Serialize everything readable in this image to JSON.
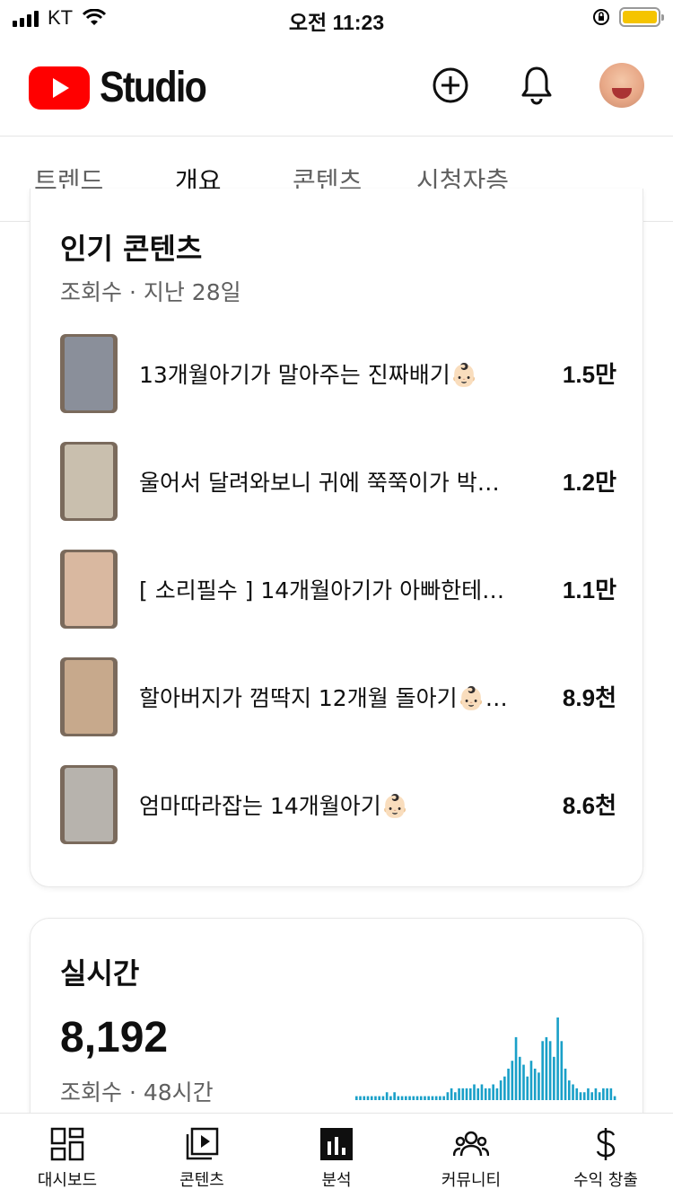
{
  "status_bar": {
    "carrier": "KT",
    "time": "오전 11:23",
    "battery_color": "#f5c400"
  },
  "header": {
    "logo_text": "Studio",
    "brand_color": "#ff0000",
    "icons": [
      "create-icon",
      "bell-icon",
      "avatar"
    ]
  },
  "tabs": [
    {
      "label": "트렌드",
      "active": false
    },
    {
      "label": "개요",
      "active": true
    },
    {
      "label": "콘텐츠",
      "active": false
    },
    {
      "label": "시청자층",
      "active": false
    }
  ],
  "popular": {
    "title": "인기 콘텐츠",
    "subtitle": "조회수 · 지난 28일",
    "videos": [
      {
        "title": "13개월아기가 말아주는 진짜배기👶🏻",
        "views": "1.5만",
        "thumb_color": "#8a8f9a"
      },
      {
        "title": "울어서 달려와보니 귀에 쭉쭉이가 박…",
        "views": "1.2만",
        "thumb_color": "#c9bfae"
      },
      {
        "title": "[ 소리필수 ] 14개월아기가 아빠한테…",
        "views": "1.1만",
        "thumb_color": "#d9b8a0"
      },
      {
        "title": "할아버지가 껌딱지 12개월 돌아기👶🏻…",
        "views": "8.9천",
        "thumb_color": "#c7a98c"
      },
      {
        "title": "엄마따라잡는 14개월아기👶🏻",
        "views": "8.6천",
        "thumb_color": "#b7b3ad"
      }
    ]
  },
  "realtime": {
    "title": "실시간",
    "count": "8,192",
    "subtitle": "조회수 · 48시간"
  },
  "chart_data": {
    "type": "bar",
    "color": "#1aa0c8",
    "values": [
      1,
      1,
      1,
      1,
      1,
      1,
      1,
      1,
      2,
      1,
      2,
      1,
      1,
      1,
      1,
      1,
      1,
      1,
      1,
      1,
      1,
      1,
      1,
      1,
      2,
      3,
      2,
      3,
      3,
      3,
      3,
      4,
      3,
      4,
      3,
      3,
      4,
      3,
      5,
      6,
      8,
      10,
      16,
      11,
      9,
      6,
      10,
      8,
      7,
      15,
      16,
      15,
      11,
      21,
      15,
      8,
      5,
      4,
      3,
      2,
      2,
      3,
      2,
      3,
      2,
      3,
      3,
      3,
      1
    ],
    "ylim": [
      0,
      21
    ],
    "grid": false,
    "xlabel": "",
    "ylabel": ""
  },
  "bottom_nav": [
    {
      "label": "대시보드",
      "icon": "dashboard-icon"
    },
    {
      "label": "콘텐츠",
      "icon": "content-icon"
    },
    {
      "label": "분석",
      "icon": "analytics-icon"
    },
    {
      "label": "커뮤니티",
      "icon": "community-icon"
    },
    {
      "label": "수익 창출",
      "icon": "monetization-icon"
    }
  ]
}
